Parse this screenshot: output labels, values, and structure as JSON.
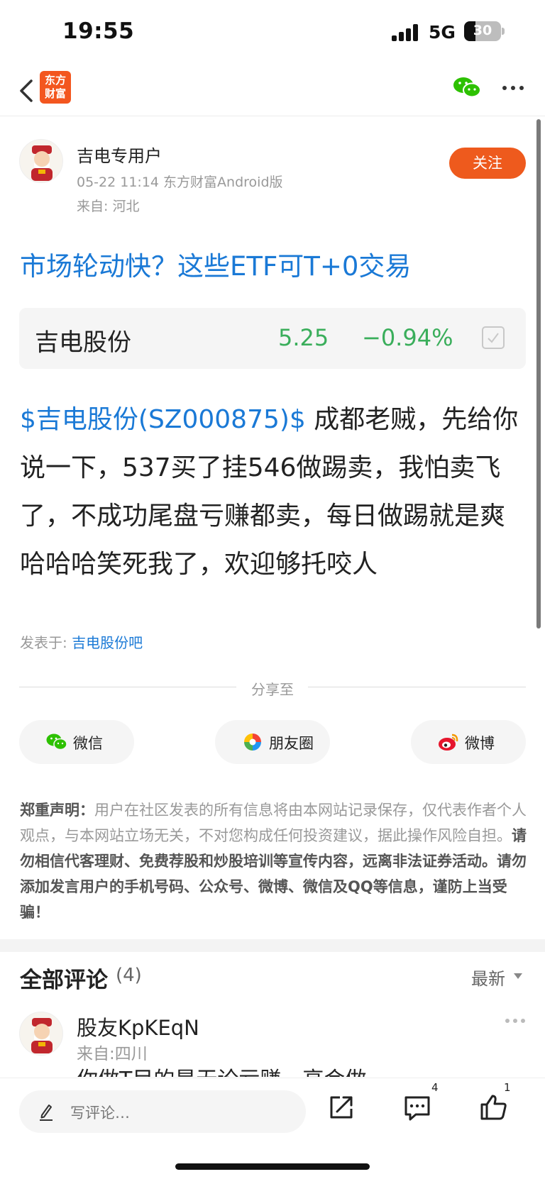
{
  "status_bar": {
    "time": "19:55",
    "network": "5G",
    "battery": "30",
    "battery_level": 0.3
  },
  "nav": {
    "logo_text_line1": "东方",
    "logo_text_line2": "财富",
    "brand_color": "#f3561f"
  },
  "author": {
    "name": "吉电专用户",
    "meta": "05-22 11:14 东方财富Android版",
    "location": "来自: 河北",
    "follow_label": "关注"
  },
  "post": {
    "title": "市场轮动快？这些ETF可T+0交易",
    "stock_card": {
      "name": "吉电股份",
      "price": "5.25",
      "change": "−0.94%"
    },
    "stock_link": "$吉电股份(SZ000875)$",
    "body_text": " 成都老贼，先给你说一下，537买了挂546做踢卖，我怕卖飞了，不成功尾盘亏赚都卖，每日做踢就是爽哈哈哈笑死我了，欢迎够托咬人",
    "posted_in_label": "发表于: ",
    "posted_in_bar": "吉电股份吧"
  },
  "share": {
    "label": "分享至",
    "wechat": "微信",
    "moments": "朋友圈",
    "weibo": "微博"
  },
  "disclaimer": {
    "heading": "郑重声明：",
    "text1": "用户在社区发表的所有信息将由本网站记录保存，仅代表作者个人观点，与本网站立场无关，不对您构成任何投资建议，据此操作风险自担。",
    "text2": "请勿相信代客理财、免费荐股和炒股培训等宣传内容，远离非法证券活动。请勿添加发言用户的手机号码、公众号、微博、微信及QQ等信息，谨防上当受骗！"
  },
  "comments": {
    "title": "全部评论",
    "count": "(4)",
    "sort": "最新",
    "items": [
      {
        "name": "股友KpKEqN",
        "location": "来自:四川",
        "text": "你做T目的是无论亏赚，高会做"
      }
    ]
  },
  "bottom_bar": {
    "input_placeholder": "写评论…",
    "comment_count": "4",
    "like_count": "1"
  }
}
